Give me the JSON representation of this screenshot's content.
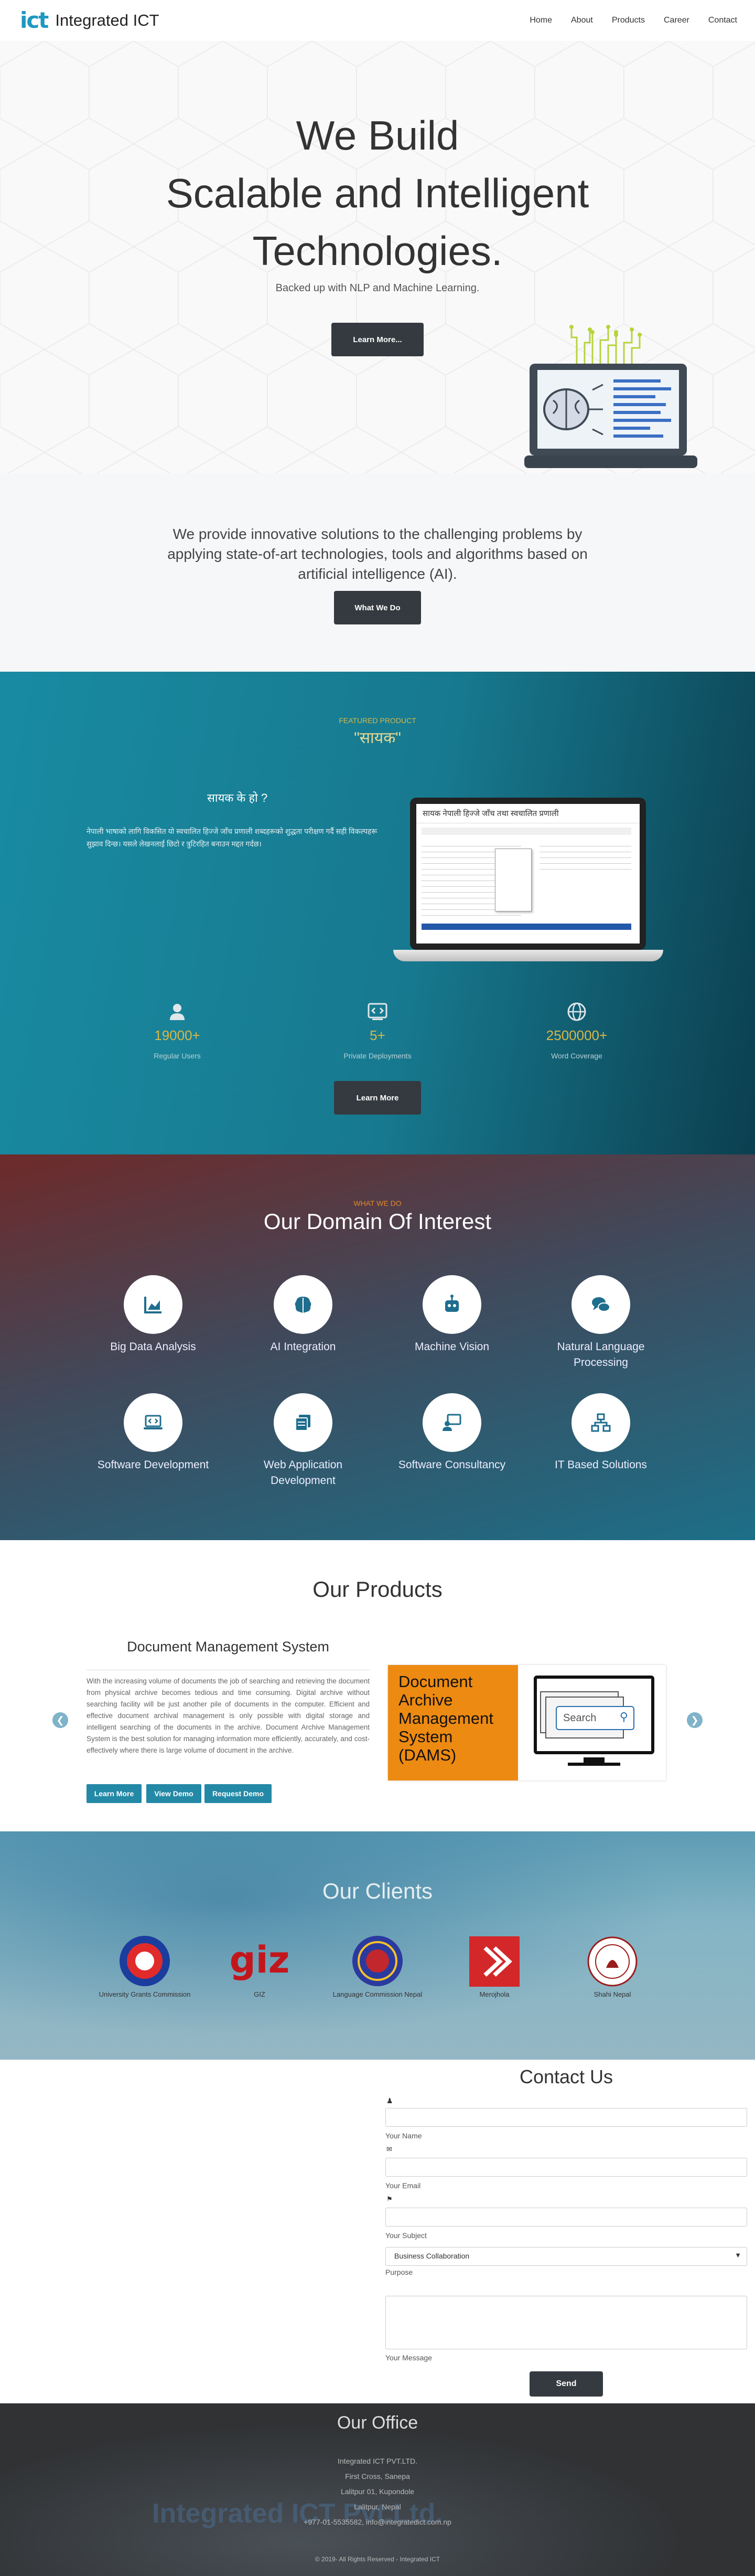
{
  "nav": {
    "logo": "ict",
    "brand": "Integrated ICT",
    "items": [
      "Home",
      "About",
      "Products",
      "Career",
      "Contact"
    ]
  },
  "hero": {
    "title_lines": [
      "We Build",
      "Scalable and Intelligent",
      "Technologies."
    ],
    "subtitle": "Backed up with NLP and Machine Learning.",
    "button": "Learn More..."
  },
  "intro": {
    "text": "We provide innovative solutions to the challenging problems by applying state-of-art technologies, tools and algorithms based on artificial intelligence (AI).",
    "button": "What We Do"
  },
  "featured": {
    "eyebrow": "FEATURED PRODUCT",
    "name": "\"सायक\"",
    "question": "सायक के हो ?",
    "description": "नेपाली भाषाको लागि विकसित यो स्वचालित हिज्जे जाँच प्रणाली शब्दहरूको शुद्धता परीक्षण गर्दै सही विकल्पहरू सुझाव दिन्छ। यसले लेखनलाई छिटो र त्रुटिरहित बनाउन मद्दत गर्दछ।",
    "screen_title": "सायक नेपाली हिज्जे जाँच तथा स्वचालित प्रणाली",
    "stats": [
      {
        "value": "19000+",
        "label": "Regular Users",
        "icon": "user-icon"
      },
      {
        "value": "5+",
        "label": "Private Deployments",
        "icon": "code-icon"
      },
      {
        "value": "2500000+",
        "label": "Word Coverage",
        "icon": "globe-icon"
      }
    ],
    "button": "Learn More",
    "accent": "#d6b74a"
  },
  "domain": {
    "eyebrow": "WHAT WE DO",
    "title": "Our Domain Of Interest",
    "items": [
      {
        "label": "Big Data Analysis",
        "icon": "chart-icon"
      },
      {
        "label": "AI Integration",
        "icon": "brain-icon"
      },
      {
        "label": "Machine Vision",
        "icon": "robot-icon"
      },
      {
        "label": "Natural Language Processing",
        "icon": "chat-icon"
      },
      {
        "label": "Software Development",
        "icon": "laptop-code-icon"
      },
      {
        "label": "Web Application Development",
        "icon": "copy-icon"
      },
      {
        "label": "Software Consultancy",
        "icon": "presenter-icon"
      },
      {
        "label": "IT Based Solutions",
        "icon": "network-icon"
      }
    ],
    "accent": "#e08a2e"
  },
  "products": {
    "title": "Our Products",
    "product_name": "Document Management System",
    "description": "With the increasing volume of documents the job of searching and retrieving the document from physical archive becomes tedious and time consuming. Digital archive without searching facility will be just another pile of documents in the computer. Efficient and effective document archival management is only possible with digital storage and intelligent searching of the documents in the archive. Document Archive Management System is the best solution for managing information more efficiently, accurately, and cost-effectively where there is large volume of document in the archive.",
    "buttons": [
      "Learn More",
      "View Demo",
      "Request Demo"
    ],
    "image_title": "Document Archive Management System (DAMS)",
    "search_placeholder": "Search"
  },
  "clients": {
    "title": "Our Clients",
    "items": [
      "University Grants Commission",
      "GIZ",
      "Language Commission Nepal",
      "Merojhola",
      "Shahi Nepal"
    ]
  },
  "contact": {
    "title": "Contact Us",
    "labels": [
      "Your Name",
      "Your Email",
      "Your Subject",
      "Purpose",
      "Your Message"
    ],
    "purpose_value": "Business Collaboration",
    "button": "Send"
  },
  "office": {
    "title": "Our Office",
    "lines": [
      "Integrated ICT PVT.LTD.",
      "First Cross, Sanepa",
      "Lalitpur 01, Kupondole",
      "Lalitpur, Nepal",
      "+977-01-5535582, info@integratedict.com.np"
    ],
    "watermark": "Integrated ICT Pvt.Ltd.",
    "copyright": "© 2019- All Rights Reserved - Integrated ICT"
  }
}
